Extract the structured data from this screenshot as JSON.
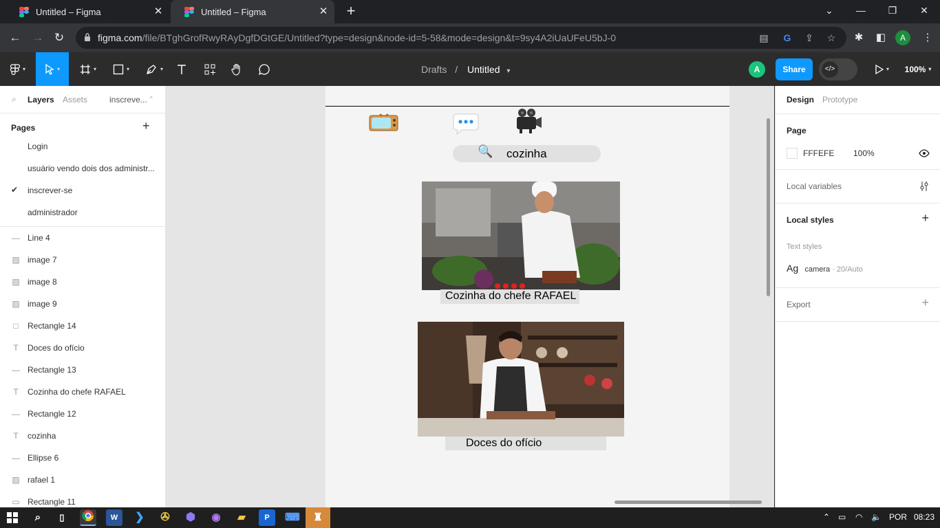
{
  "browser": {
    "tabs": [
      {
        "title": "Untitled – Figma"
      },
      {
        "title": "Untitled – Figma"
      }
    ],
    "url_host": "figma.com",
    "url_path": "/file/BTghGrofRwyRAyDgfDGtGE/Untitled?type=design&node-id=5-58&mode=design&t=9sy4A2iUaUFeU5bJ-0",
    "profile_initial": "A"
  },
  "toolbar": {
    "breadcrumb_parent": "Drafts",
    "breadcrumb_sep": "/",
    "file_title": "Untitled",
    "avatar_initial": "A",
    "share_label": "Share",
    "zoom": "100%"
  },
  "left_panel": {
    "tabs": [
      "Layers",
      "Assets"
    ],
    "page_dropdown": "inscreve...",
    "pages_label": "Pages",
    "pages": [
      {
        "name": "Login",
        "active": false
      },
      {
        "name": "usuário vendo dois dos administr...",
        "active": false
      },
      {
        "name": "inscrever-se",
        "active": true
      },
      {
        "name": "administrador",
        "active": false
      }
    ],
    "layers": [
      {
        "name": "Line 4",
        "icon": "line-icon"
      },
      {
        "name": "image 7",
        "icon": "image-icon"
      },
      {
        "name": "image 8",
        "icon": "image-icon"
      },
      {
        "name": "image 9",
        "icon": "image-icon"
      },
      {
        "name": "Rectangle 14",
        "icon": "rectangle-icon"
      },
      {
        "name": "Doces do ofício",
        "icon": "text-icon"
      },
      {
        "name": "Rectangle 13",
        "icon": "line-icon"
      },
      {
        "name": "Cozinha do chefe RAFAEL",
        "icon": "text-icon"
      },
      {
        "name": "Rectangle 12",
        "icon": "line-icon"
      },
      {
        "name": "cozinha",
        "icon": "text-icon"
      },
      {
        "name": "Ellipse 6",
        "icon": "line-icon"
      },
      {
        "name": "rafael 1",
        "icon": "image-icon"
      },
      {
        "name": "Rectangle 11",
        "icon": "rectangle-icon"
      }
    ]
  },
  "canvas": {
    "search_text": "cozinha",
    "caption_1": "Cozinha do chefe RAFAEL",
    "caption_2": "Doces do ofício"
  },
  "right_panel": {
    "tabs": [
      "Design",
      "Prototype"
    ],
    "page_label": "Page",
    "page_color": "FFFEFE",
    "page_opacity": "100%",
    "local_variables": "Local variables",
    "local_styles": "Local styles",
    "text_styles": "Text styles",
    "style_ag": "Ag",
    "style_name": "camera",
    "style_meta": " · 20/Auto",
    "export": "Export"
  },
  "taskbar": {
    "language": "POR",
    "time": "08:23"
  },
  "colors": {
    "figma_blue": "#0d99ff",
    "figma_dark": "#2c2c2c",
    "chrome_dark": "#202124"
  }
}
